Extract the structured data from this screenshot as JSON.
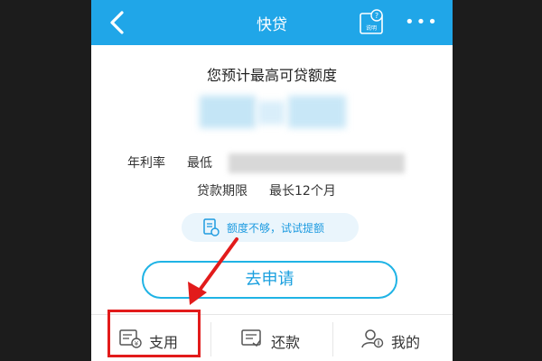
{
  "header": {
    "title": "快贷",
    "help_label": "说明",
    "help_glyph": "?",
    "more_glyph": "•••"
  },
  "main": {
    "headline": "您预计最高可贷额度",
    "rate_label": "年利率",
    "rate_prefix": "最低",
    "term_label": "贷款期限",
    "term_value": "最长12个月",
    "tip_text": "额度不够，试试提额",
    "apply_label": "去申请"
  },
  "nav": {
    "items": [
      {
        "label": "支用",
        "icon": "withdraw-icon"
      },
      {
        "label": "还款",
        "icon": "repay-icon"
      },
      {
        "label": "我的",
        "icon": "profile-icon"
      }
    ]
  },
  "colors": {
    "brand": "#20a6e8",
    "accent": "#1fb3e5",
    "highlight": "#e21b1b"
  }
}
